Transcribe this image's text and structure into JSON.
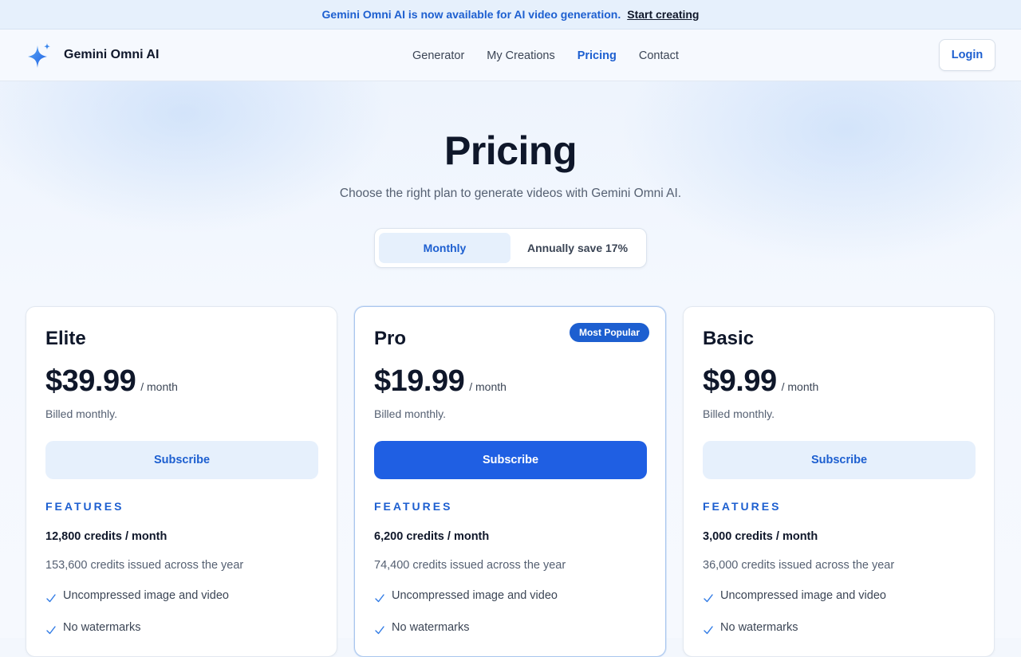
{
  "announcement": {
    "message": "Gemini Omni AI is now available for AI video generation.",
    "link": "Start creating"
  },
  "brand": {
    "name": "Gemini Omni AI",
    "icon": "sparkle-icon"
  },
  "nav": {
    "links": [
      "Generator",
      "My Creations",
      "Pricing",
      "Contact"
    ],
    "active": "Pricing",
    "login": "Login"
  },
  "hero": {
    "title": "Pricing",
    "subtitle": "Choose the right plan to generate videos with Gemini Omni AI."
  },
  "billing_toggle": {
    "options": [
      "Monthly",
      "Annually save 17%"
    ],
    "selected": "Monthly"
  },
  "plans": [
    {
      "name": "Elite",
      "price": "$39.99",
      "period": "/ month",
      "billed": "Billed monthly.",
      "button": "Subscribe",
      "features_label": "FEATURES",
      "credits": "12,800 credits / month",
      "credits_year": "153,600 credits issued across the year",
      "features": [
        "Uncompressed image and video",
        "No watermarks"
      ]
    },
    {
      "name": "Pro",
      "badge": "Most Popular",
      "price": "$19.99",
      "period": "/ month",
      "billed": "Billed monthly.",
      "button": "Subscribe",
      "features_label": "FEATURES",
      "credits": "6,200 credits / month",
      "credits_year": "74,400 credits issued across the year",
      "features": [
        "Uncompressed image and video",
        "No watermarks"
      ]
    },
    {
      "name": "Basic",
      "price": "$9.99",
      "period": "/ month",
      "billed": "Billed monthly.",
      "button": "Subscribe",
      "features_label": "FEATURES",
      "credits": "3,000 credits / month",
      "credits_year": "36,000 credits issued across the year",
      "features": [
        "Uncompressed image and video",
        "No watermarks"
      ]
    }
  ],
  "colors": {
    "accent": "#1d5fd0",
    "primary_button": "#1f5fe3",
    "soft_button": "#e6f0fc",
    "text": "#0f172a",
    "muted": "#556072"
  }
}
